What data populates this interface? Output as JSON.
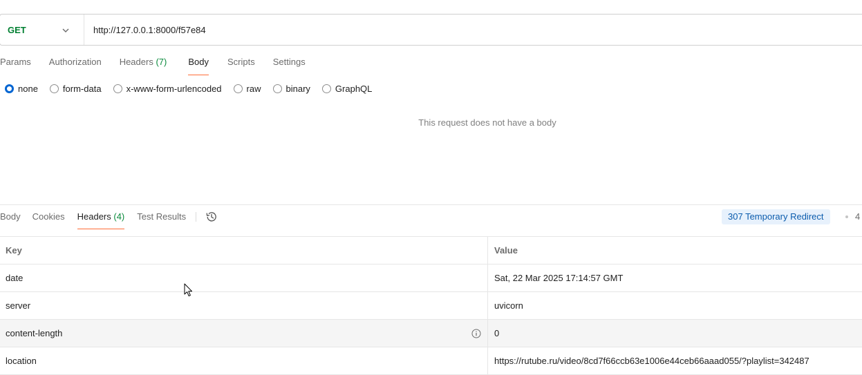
{
  "request": {
    "method": "GET",
    "url": "http://127.0.0.1:8000/f57e84"
  },
  "request_tabs": [
    {
      "label": "Params",
      "count": ""
    },
    {
      "label": "Authorization",
      "count": ""
    },
    {
      "label": "Headers",
      "count": "(7)"
    },
    {
      "label": "Body",
      "count": "",
      "active": true
    },
    {
      "label": "Scripts",
      "count": ""
    },
    {
      "label": "Settings",
      "count": ""
    }
  ],
  "body_types": {
    "none": "none",
    "form_data": "form-data",
    "urlencoded": "x-www-form-urlencoded",
    "raw": "raw",
    "binary": "binary",
    "graphql": "GraphQL",
    "selected": "none"
  },
  "empty_body_message": "This request does not have a body",
  "response_tabs": [
    {
      "label": "Body",
      "count": ""
    },
    {
      "label": "Cookies",
      "count": ""
    },
    {
      "label": "Headers",
      "count": "(4)",
      "active": true
    },
    {
      "label": "Test Results",
      "count": ""
    }
  ],
  "response_status": {
    "badge": "307 Temporary Redirect",
    "time_partial": "4",
    "badge_color": "#e7f1fc",
    "badge_text_color": "#0b5cad"
  },
  "headers_table": {
    "columns": {
      "key": "Key",
      "value": "Value"
    },
    "rows": [
      {
        "key": "date",
        "value": "Sat, 22 Mar 2025 17:14:57 GMT"
      },
      {
        "key": "server",
        "value": "uvicorn"
      },
      {
        "key": "content-length",
        "value": "0"
      },
      {
        "key": "location",
        "value": "https://rutube.ru/video/8cd7f66ccb63e1006e44ceb66aaad055/?playlist=342487"
      }
    ]
  },
  "icons": {
    "method_dropdown": "chevron-down-icon",
    "history": "history-icon",
    "info": "info-icon",
    "cursor": "mouse-cursor-icon"
  },
  "colors": {
    "accent": "#ff6c37",
    "method_get": "#007f31",
    "radio_selected": "#0265d2",
    "count_green": "#0a8a3c"
  }
}
